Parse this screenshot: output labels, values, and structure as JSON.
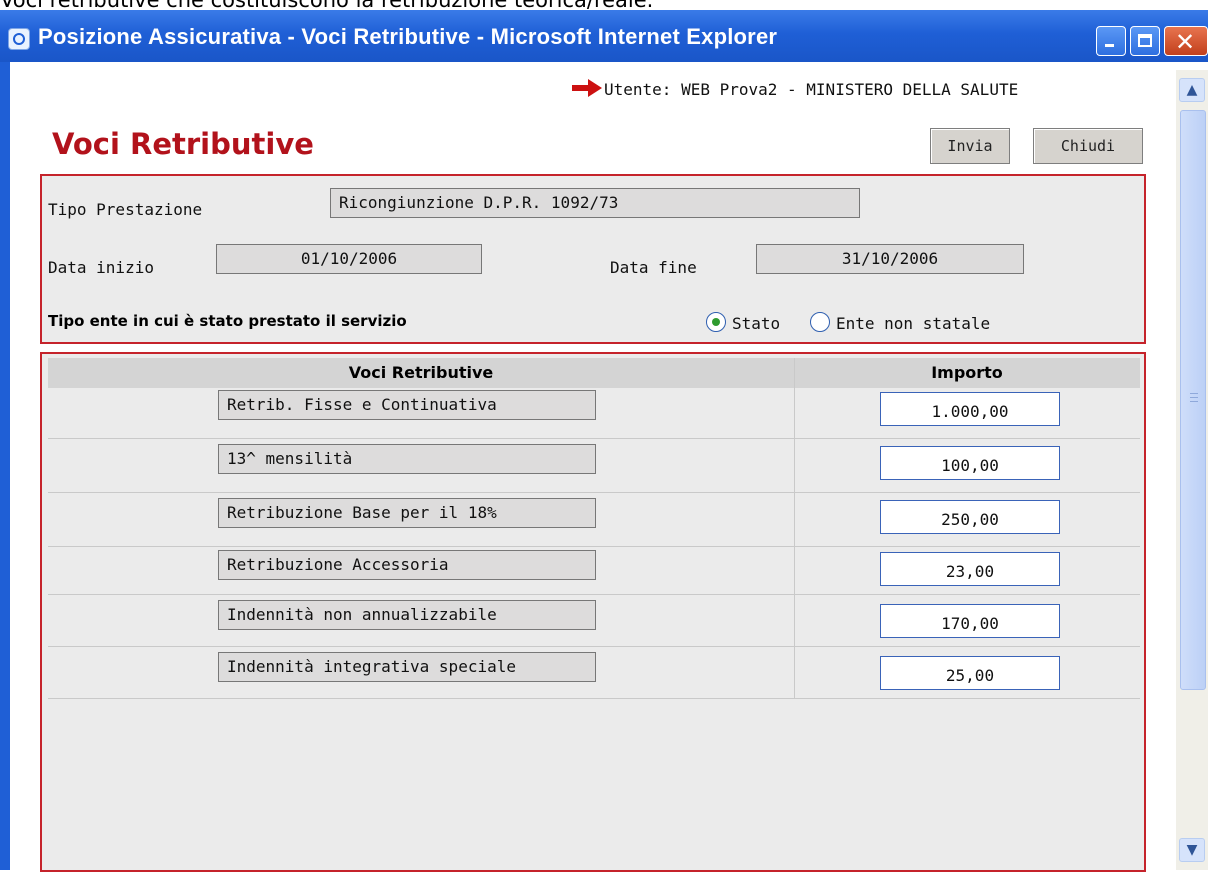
{
  "caption": "Voci retributive che costituiscono la retribuzione teorica/reale.",
  "window": {
    "title": "Posizione Assicurativa - Voci Retributive - Microsoft Internet Explorer",
    "icon": "ie-icon",
    "controls": {
      "minimize": "minimize-icon",
      "maximize": "maximize-icon",
      "close": "✕"
    }
  },
  "header": {
    "user_line": "Utente: WEB Prova2 - MINISTERO DELLA SALUTE",
    "arrow_icon": "red-arrow-icon",
    "arrow_color": "#cc1111"
  },
  "page": {
    "title": "Voci Retributive",
    "title_color": "#b2121b",
    "buttons": {
      "send": "Invia",
      "close": "Chiudi"
    }
  },
  "form": {
    "tipo_prestazione_label": "Tipo Prestazione",
    "tipo_prestazione_value": "Ricongiunzione D.P.R. 1092/73",
    "data_inizio_label": "Data inizio",
    "data_inizio_value": "01/10/2006",
    "data_fine_label": "Data fine",
    "data_fine_value": "31/10/2006",
    "tipo_ente_label": "Tipo ente in cui è stato prestato il servizio",
    "radio_options": [
      {
        "label": "Stato",
        "checked": true
      },
      {
        "label": "Ente non statale",
        "checked": false
      }
    ]
  },
  "table": {
    "headers": [
      "Voci Retributive",
      "Importo"
    ],
    "rows": [
      {
        "voce": "Retrib. Fisse e Continuativa",
        "importo": "1.000,00"
      },
      {
        "voce": "13^ mensilità",
        "importo": "100,00"
      },
      {
        "voce": "Retribuzione Base per il 18%",
        "importo": "250,00"
      },
      {
        "voce": "Retribuzione Accessoria",
        "importo": "23,00"
      },
      {
        "voce": "Indennità non annualizzabile",
        "importo": "170,00"
      },
      {
        "voce": "Indennità integrativa speciale",
        "importo": "25,00"
      }
    ]
  },
  "colors": {
    "panel_border": "#c5232b",
    "titlebar": "#1f5fd6"
  }
}
